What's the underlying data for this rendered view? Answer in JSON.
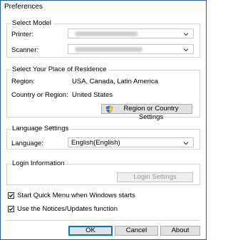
{
  "window": {
    "title": "Preferences"
  },
  "select_model": {
    "label": "Select Model",
    "printer_label": "Printer:",
    "scanner_label": "Scanner:"
  },
  "residence": {
    "label": "Select Your Place of Residence",
    "region_label": "Region:",
    "region_value": "USA, Canada, Latin America",
    "country_label": "Country or Region:",
    "country_value": "United States",
    "settings_button": "Region or Country Settings"
  },
  "language": {
    "label": "Language Settings",
    "language_label": "Language:",
    "language_value": "English(English)"
  },
  "login": {
    "label": "Login Information",
    "settings_button": "Login Settings"
  },
  "options": {
    "start_quick_menu": {
      "label": "Start Quick Menu when Windows starts",
      "checked": true
    },
    "notices_updates": {
      "label": "Use the Notices/Updates function",
      "checked": true
    }
  },
  "buttons": {
    "ok": "OK",
    "cancel": "Cancel",
    "about": "About"
  }
}
